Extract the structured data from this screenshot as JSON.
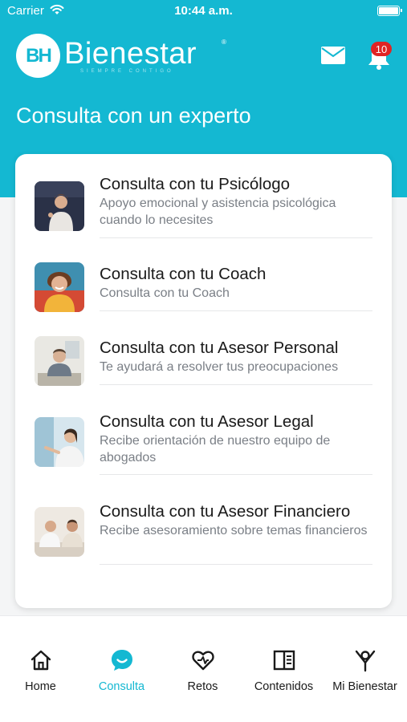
{
  "status_bar": {
    "carrier": "Carrier",
    "time": "10:44 a.m."
  },
  "brand": {
    "logo_mark": "BH",
    "name": "Bienestar",
    "registered": "®",
    "tagline": "SIEMPRE CONTIGO"
  },
  "header": {
    "notification_count": "10",
    "mail_icon": "mail-icon",
    "bell_icon": "bell-icon"
  },
  "page": {
    "title": "Consulta con un experto"
  },
  "experts": [
    {
      "title": "Consulta con tu Psicólogo",
      "subtitle": "Apoyo emocional y asistencia psicológica cuando lo necesites"
    },
    {
      "title": "Consulta con tu Coach",
      "subtitle": "Consulta con tu Coach"
    },
    {
      "title": "Consulta con tu Asesor Personal",
      "subtitle": "Te ayudará a resolver tus preocupaciones"
    },
    {
      "title": "Consulta con tu Asesor Legal",
      "subtitle": "Recibe orientación de nuestro equipo de abogados"
    },
    {
      "title": "Consulta con tu Asesor Financiero",
      "subtitle": "Recibe asesoramiento sobre temas financieros"
    }
  ],
  "tabs": [
    {
      "label": "Home",
      "icon": "home-icon"
    },
    {
      "label": "Consulta",
      "icon": "chat-bubble-icon",
      "active": true
    },
    {
      "label": "Retos",
      "icon": "heart-icon"
    },
    {
      "label": "Contenidos",
      "icon": "book-icon"
    },
    {
      "label": "Mi Bienestar",
      "icon": "person-icon"
    }
  ],
  "colors": {
    "accent": "#14b8d2",
    "badge": "#e02424",
    "text": "#1a1a1a",
    "muted": "#7a7f86"
  }
}
